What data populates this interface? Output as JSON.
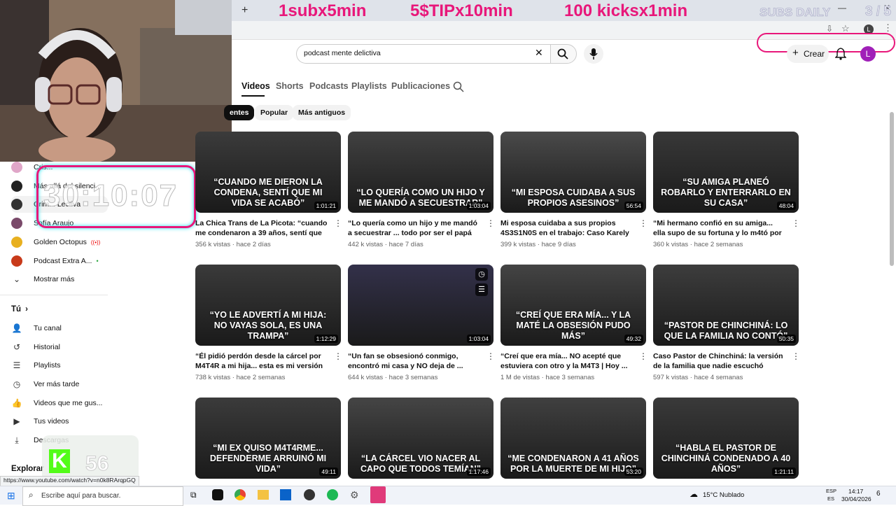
{
  "overlay": {
    "promo1": "1subx5min",
    "promo2": "5$TIPx10min",
    "promo3": "100 kicksx1min",
    "subs_badge": "SUBS DAILY",
    "subs_count": "3 / 5",
    "timer": "30:10:07",
    "kick_count": "56",
    "colors": {
      "promo": "#e8177a",
      "kick": "#53fc18"
    }
  },
  "masthead": {
    "search_value": "podcast mente delictiva",
    "create_label": "Crear",
    "avatar_letter": "L"
  },
  "channel_tabs": [
    "Videos",
    "Shorts",
    "Podcasts",
    "Playlists",
    "Publicaciones"
  ],
  "sort_chips": [
    "entes",
    "Popular",
    "Más antiguos"
  ],
  "sidebar": {
    "subscriptions": [
      {
        "label": "Cris...",
        "icon": "channel-avatar-icon"
      },
      {
        "label": "Más allá del silenci...",
        "icon": "channel-avatar-icon"
      },
      {
        "label": "Crim... Lectiva",
        "icon": "channel-avatar-icon"
      },
      {
        "label": "Sofía Araujo",
        "icon": "channel-avatar-icon"
      },
      {
        "label": "Golden Octopus",
        "icon": "channel-avatar-icon"
      },
      {
        "label": "Podcast Extra A...",
        "icon": "channel-avatar-icon"
      }
    ],
    "show_more": "Mostrar más",
    "you_header": "Tú",
    "you_items": [
      {
        "label": "Tu canal",
        "icon": "user-icon"
      },
      {
        "label": "Historial",
        "icon": "history-icon"
      },
      {
        "label": "Playlists",
        "icon": "playlist-icon"
      },
      {
        "label": "Ver más tarde",
        "icon": "clock-icon"
      },
      {
        "label": "Videos que me gus...",
        "icon": "like-icon"
      },
      {
        "label": "Tus videos",
        "icon": "video-icon"
      },
      {
        "label": "Descargas",
        "icon": "download-icon"
      }
    ],
    "explore": "Explorar"
  },
  "videos": [
    {
      "caption": "“CUANDO ME DIERON LA CONDENA, SENTÍ QUE MI VIDA SE ACABÓ”",
      "duration": "1:01:21",
      "title": "La Chica Trans de La Picota: “cuando me condenaron a 39 años, sentí que ...",
      "meta": "356 k vistas · hace 2 días",
      "bg": "#3b3b3b"
    },
    {
      "caption": "“LO QUERÍA COMO UN HIJO Y ME MANDÓ A SECUESTRAR”",
      "duration": "1:03:04",
      "title": "“Lo quería como un hijo y me mandó a secuestrar ... todo por ser el papá de ...",
      "meta": "442 k vistas · hace 7 días",
      "bg": "#414141"
    },
    {
      "caption": "“MI ESPOSA CUIDABA A SUS PROPIOS ASESINOS”",
      "duration": "56:54",
      "title": "Mi esposa cuidaba a sus propios 4S3S1N0S en el trabajo: Caso Karely ...",
      "meta": "399 k vistas · hace 9 días",
      "bg": "#4a4a4a"
    },
    {
      "caption": "“SU AMIGA PLANEÓ ROBARLO Y ENTERRARLO EN SU CASA”",
      "duration": "48:04",
      "title": "“Mi hermano confió en su amiga... ella supo de su fortuna y lo m4tó por el ...",
      "meta": "360 k vistas · hace 2 semanas",
      "bg": "#383838"
    },
    {
      "caption": "“YO LE ADVERTÍ A MI HIJA: NO VAYAS SOLA, ES UNA TRAMPA”",
      "duration": "1:12:29",
      "title": "“Él pidió perdón desde la cárcel por M4T4R a mi hija... esta es mi versión ...",
      "meta": "738 k vistas · hace 2 semanas",
      "bg": "#3a3a3a"
    },
    {
      "caption": "",
      "duration": "1:03:04",
      "title": "“Un fan se obsesionó conmigo, encontró mi casa y NO deja de ...",
      "meta": "644 k vistas · hace 3 semanas",
      "bg": "#33314a"
    },
    {
      "caption": "“CREÍ QUE ERA MÍA... Y LA MATÉ LA OBSESIÓN PUDO MÁS”",
      "duration": "49:32",
      "title": "“Creí que era mía... NO acepté que estuviera con otro y la M4T3 | Hoy ...",
      "meta": "1 M de vistas · hace 3 semanas",
      "bg": "#444444"
    },
    {
      "caption": "“PASTOR DE CHINCHINÁ: LO QUE LA FAMILIA NO CONTÓ”",
      "duration": "50:35",
      "title": "Caso Pastor de Chinchiná: la versión de la familia que nadie escuchó",
      "meta": "597 k vistas · hace 4 semanas",
      "bg": "#3d3d3d"
    },
    {
      "caption": "“MI EX QUISO M4T4RME... DEFENDERME ARRUINÓ MI VIDA”",
      "duration": "49:11",
      "title": "",
      "meta": "",
      "bg": "#3b3b3b"
    },
    {
      "caption": "“LA CÁRCEL VIO NACER AL CAPO QUE TODOS TEMÍAN”",
      "duration": "1:17:46",
      "title": "",
      "meta": "",
      "bg": "#454545"
    },
    {
      "caption": "“ME CONDENARON A 41 AÑOS POR LA MUERTE DE MI HIJO”",
      "duration": "53:20",
      "title": "",
      "meta": "",
      "bg": "#404040"
    },
    {
      "caption": "“HABLA EL PASTOR DE CHINCHINÁ CONDENADO A 40 AÑOS”",
      "duration": "1:21:11",
      "title": "",
      "meta": "",
      "bg": "#3a3a3a"
    }
  ],
  "status_url": "https://www.youtube.com/watch?v=n0k8RArqpGQ",
  "taskbar": {
    "search_placeholder": "Escribe aquí para buscar.",
    "weather": "15°C  Nublado",
    "lang1": "ESP",
    "lang2": "ES",
    "time": "14:17",
    "date": "30/04/2026",
    "notif_count": "6"
  }
}
